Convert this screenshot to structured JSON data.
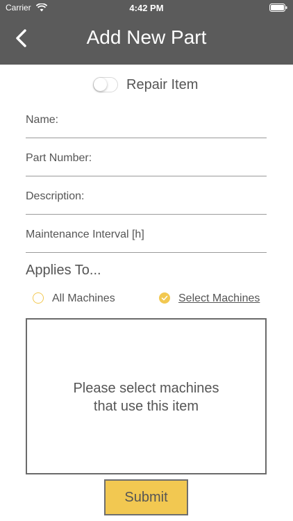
{
  "status_bar": {
    "carrier": "Carrier",
    "time": "4:42 PM"
  },
  "header": {
    "title": "Add New Part",
    "background_color": "#5b5b5b"
  },
  "repair_toggle": {
    "label": "Repair Item",
    "checked": false
  },
  "fields": {
    "name": {
      "label": "Name:",
      "value": ""
    },
    "part_number": {
      "label": "Part Number:",
      "value": ""
    },
    "description": {
      "label": "Description:",
      "value": ""
    },
    "maintenance_interval": {
      "label": "Maintenance Interval [h]",
      "value": ""
    }
  },
  "applies_to": {
    "heading": "Applies To...",
    "options": [
      {
        "label": "All Machines",
        "selected": false
      },
      {
        "label": "Select Machines",
        "selected": true
      }
    ],
    "accent_color": "#f2c851"
  },
  "machines_box": {
    "message": "Please select machines\nthat use this item"
  },
  "submit": {
    "label": "Submit",
    "color": "#f2c851"
  }
}
